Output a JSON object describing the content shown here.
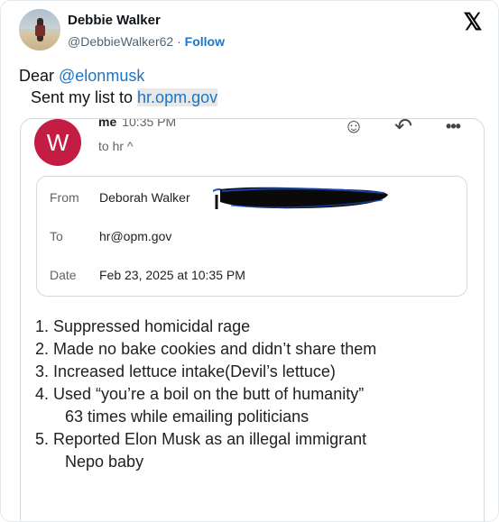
{
  "author": {
    "name": "Debbie Walker",
    "handle": "@DebbieWalker62",
    "separator": "·",
    "follow_label": "Follow"
  },
  "x_logo": "𝕏",
  "tweet": {
    "line1_prefix": "Dear ",
    "line1_mention": "@elonmusk",
    "line2_prefix": "Sent my list to ",
    "line2_link": "hr.opm.gov"
  },
  "email": {
    "avatar_letter": "W",
    "avatar_color": "#c41d44",
    "sender": "me",
    "time": "10:35 PM",
    "to_summary": "to hr ^",
    "icons": [
      "emoji-icon",
      "reply-icon",
      "more-icon"
    ],
    "details": {
      "from_label": "From",
      "from_value": "Deborah Walker",
      "to_label": "To",
      "to_value": "hr@opm.gov",
      "date_label": "Date",
      "date_value": "Feb 23, 2025 at 10:35 PM"
    },
    "list": [
      "1. Suppressed homicidal rage",
      "2. Made no bake cookies and didn’t share them",
      "3. Increased lettuce intake(Devil’s lettuce)",
      "4. Used “you’re a boil on the butt of humanity”",
      "63 times while emailing politicians",
      "5. Reported Elon Musk as an illegal immigrant",
      "Nepo baby"
    ]
  },
  "colors": {
    "link": "#1d75c5",
    "text": "#0f1419",
    "muted": "#536471"
  }
}
